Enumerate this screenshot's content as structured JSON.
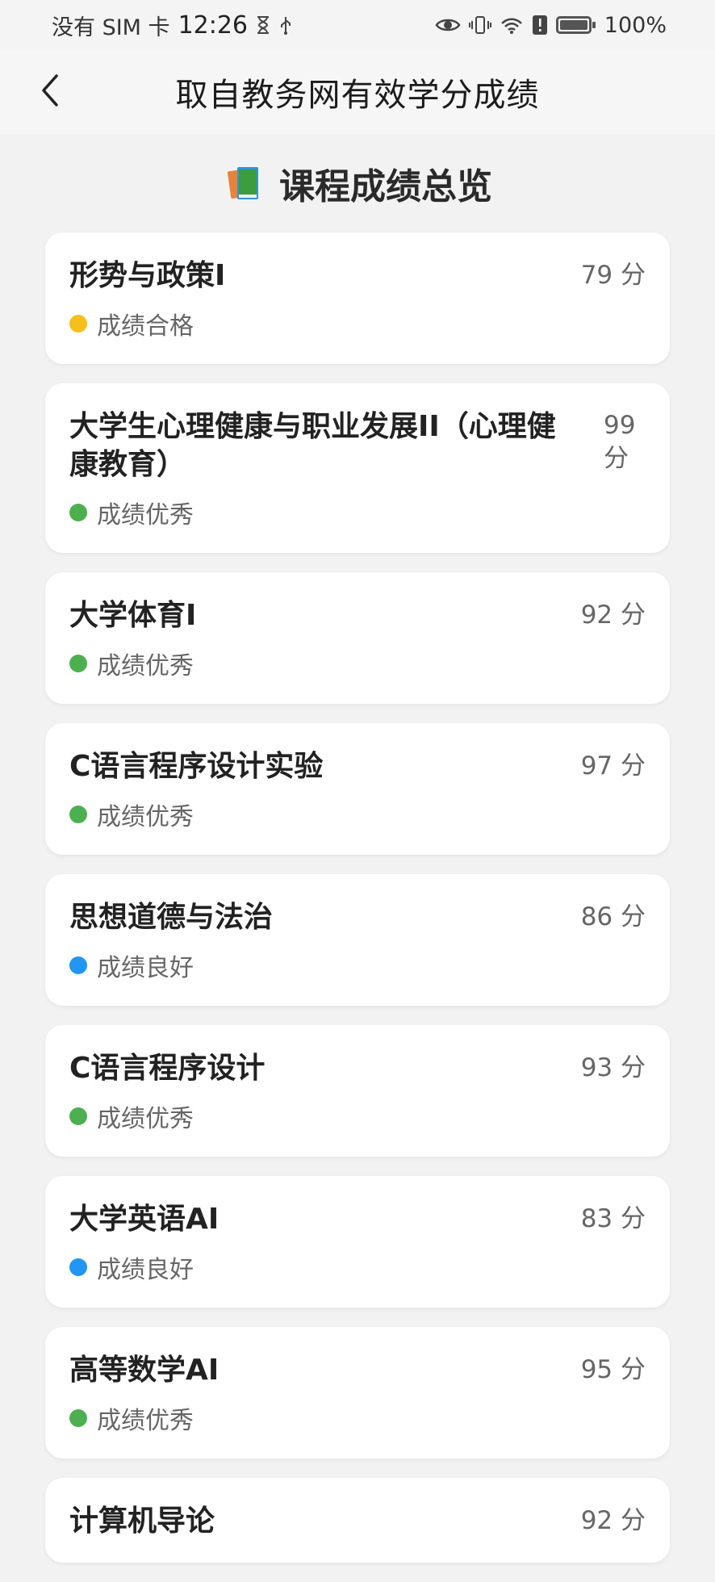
{
  "status_bar": {
    "carrier": "没有 SIM 卡",
    "time": "12:26",
    "battery": "100%"
  },
  "app_bar": {
    "title": "取自教务网有效学分成绩"
  },
  "overview": {
    "title": "课程成绩总览",
    "icon": "books-icon"
  },
  "colors": {
    "pass": "#f7bf1b",
    "excellent": "#4caf50",
    "good": "#2196f3"
  },
  "courses": [
    {
      "name": "形势与政策I",
      "score": "79 分",
      "status": "成绩合格",
      "level": "pass"
    },
    {
      "name": "大学生心理健康与职业发展II（心理健康教育）",
      "score": "99 分",
      "status": "成绩优秀",
      "level": "excellent"
    },
    {
      "name": "大学体育I",
      "score": "92 分",
      "status": "成绩优秀",
      "level": "excellent"
    },
    {
      "name": "C语言程序设计实验",
      "score": "97 分",
      "status": "成绩优秀",
      "level": "excellent"
    },
    {
      "name": "思想道德与法治",
      "score": "86 分",
      "status": "成绩良好",
      "level": "good"
    },
    {
      "name": "C语言程序设计",
      "score": "93 分",
      "status": "成绩优秀",
      "level": "excellent"
    },
    {
      "name": "大学英语AI",
      "score": "83 分",
      "status": "成绩良好",
      "level": "good"
    },
    {
      "name": "高等数学AI",
      "score": "95 分",
      "status": "成绩优秀",
      "level": "excellent"
    },
    {
      "name": "计算机导论",
      "score": "92 分",
      "status": "",
      "level": "excellent"
    }
  ]
}
